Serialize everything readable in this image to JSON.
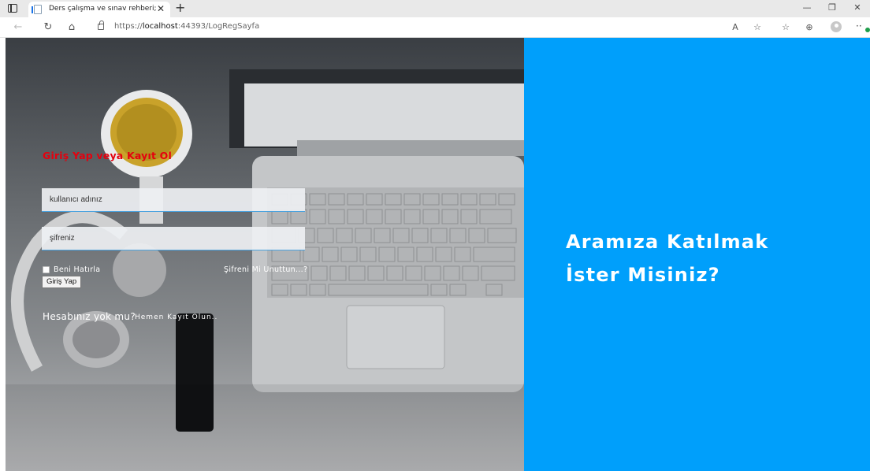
{
  "browser": {
    "tab_title": "Ders çalışma ve sınav rehberi;",
    "url_prefix": "https://",
    "url_host": "localhost",
    "url_path": ":44393/LogRegSayfa",
    "new_tab_icon": "plus-icon",
    "window_controls": [
      "minimize-icon",
      "restore-icon",
      "close-icon"
    ]
  },
  "login": {
    "title": "Giriş Yap veya Kayıt Ol",
    "title_color": "#e5000e",
    "username_placeholder": "kullanıcı adınız",
    "password_placeholder": "şifreniz",
    "remember_label": "Beni Hatırla",
    "forgot_label": "Şifreni Mi Unuttun...?",
    "submit_label": "Giriş Yap",
    "no_account_text": "Hesabınız yok mu?",
    "register_link": "Hemen Kayıt Olun.."
  },
  "promo": {
    "line1": "Aramıza Katılmak",
    "line2": "İster Misiniz?",
    "background_color": "#009ffb"
  }
}
